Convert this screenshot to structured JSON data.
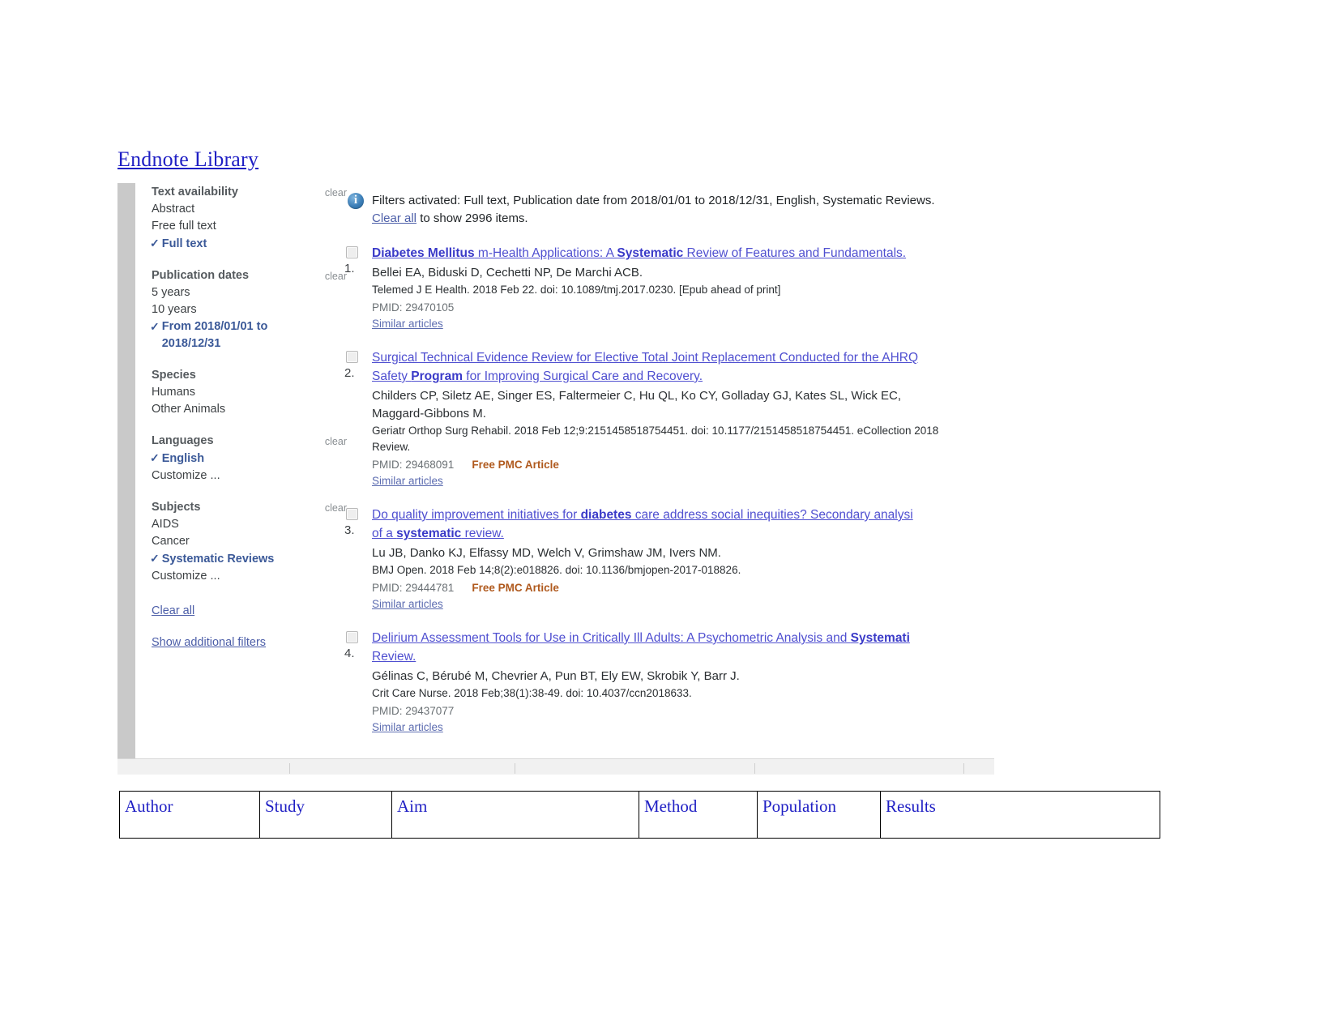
{
  "document": {
    "title_link": "Endnote Library"
  },
  "sidebar": {
    "groups": [
      {
        "heading": "Text availability",
        "clear_label": "clear",
        "has_clear": true,
        "items": [
          {
            "label": "Abstract",
            "selected": false
          },
          {
            "label": "Free full text",
            "selected": false
          },
          {
            "label": "Full text",
            "selected": true
          }
        ]
      },
      {
        "heading": "Publication dates",
        "clear_label": "clear",
        "has_clear": true,
        "items": [
          {
            "label": "5 years",
            "selected": false
          },
          {
            "label": "10 years",
            "selected": false
          },
          {
            "label": "From 2018/01/01 to 2018/12/31",
            "selected": true
          }
        ]
      },
      {
        "heading": "Species",
        "clear_label": "",
        "has_clear": false,
        "items": [
          {
            "label": "Humans",
            "selected": false
          },
          {
            "label": "Other Animals",
            "selected": false
          }
        ]
      },
      {
        "heading": "Languages",
        "clear_label": "clear",
        "has_clear": true,
        "items": [
          {
            "label": "English",
            "selected": true
          },
          {
            "label": "Customize ...",
            "selected": false
          }
        ]
      },
      {
        "heading": "Subjects",
        "clear_label": "clear",
        "has_clear": true,
        "items": [
          {
            "label": "AIDS",
            "selected": false
          },
          {
            "label": "Cancer",
            "selected": false
          },
          {
            "label": "Systematic Reviews",
            "selected": true
          },
          {
            "label": "Customize ...",
            "selected": false
          }
        ]
      }
    ],
    "clear_all_link": "Clear all",
    "show_additional_filters_link": "Show additional filters"
  },
  "banner": {
    "icon": "info-icon",
    "line1": "Filters activated: Full text, Publication date from 2018/01/01 to 2018/12/31, English, Systematic Reviews.",
    "clear_all": "Clear all",
    "line2_tail": " to show 2996 items."
  },
  "results": [
    {
      "number": "1.",
      "title_line1_pre": "",
      "title_bold1": "Diabetes Mellitus",
      "title_mid": " m-Health Applications: A ",
      "title_bold2": "Systematic",
      "title_post": " Review of Features and Fundamentals.",
      "title_line2": "",
      "authors": "Bellei EA, Biduski D, Cechetti NP, De Marchi ACB.",
      "source": "Telemed J E Health. 2018 Feb 22. doi: 10.1089/tmj.2017.0230. [Epub ahead of print]",
      "source2": "",
      "pmid": "PMID: 29470105",
      "pmc_tag": "",
      "similar": "Similar articles"
    },
    {
      "number": "2.",
      "title_line1_pre": "Surgical Technical Evidence Review for Elective Total Joint Replacement Conducted for the AHRQ",
      "title_bold1": "",
      "title_mid": "",
      "title_bold2": "",
      "title_post": "",
      "title_line2_pre": "Safety ",
      "title_line2_bold": "Program",
      "title_line2_post": " for Improving Surgical Care and Recovery.",
      "authors": "Childers CP, Siletz AE, Singer ES, Faltermeier C, Hu QL, Ko CY, Golladay GJ, Kates SL, Wick EC,",
      "authors2": "Maggard-Gibbons M.",
      "source": "Geriatr Orthop Surg Rehabil. 2018 Feb 12;9:2151458518754451. doi: 10.1177/2151458518754451. eCollection 2018",
      "source2": "Review.",
      "pmid": "PMID: 29468091",
      "pmc_tag": "Free PMC Article",
      "similar": "Similar articles"
    },
    {
      "number": "3.",
      "title_line1_pre": "Do quality improvement initiatives for ",
      "title_bold1": "diabetes",
      "title_mid": " care address social inequities? Secondary analysi",
      "title_line2_pre": "of a ",
      "title_line2_bold": "systematic",
      "title_line2_post": " review.",
      "authors": "Lu JB, Danko KJ, Elfassy MD, Welch V, Grimshaw JM, Ivers NM.",
      "source": "BMJ Open. 2018 Feb 14;8(2):e018826. doi: 10.1136/bmjopen-2017-018826.",
      "source2": "",
      "pmid": "PMID: 29444781",
      "pmc_tag": "Free PMC Article",
      "similar": "Similar articles"
    },
    {
      "number": "4.",
      "title_line1_pre": "Delirium Assessment Tools for Use in Critically Ill Adults: A Psychometric Analysis and ",
      "title_bold1": "Systemati",
      "title_mid": "",
      "title_line2_pre": "Review.",
      "title_line2_bold": "",
      "title_line2_post": "",
      "authors": "Gélinas C, Bérubé M, Chevrier A, Pun BT, Ely EW, Skrobik Y, Barr J.",
      "source": "Crit Care Nurse. 2018 Feb;38(1):38-49. doi: 10.4037/ccn2018633.",
      "source2": "",
      "pmid": "PMID: 29437077",
      "pmc_tag": "",
      "similar": "Similar articles"
    }
  ],
  "table": {
    "headers": [
      "Author",
      "Study",
      "Aim",
      "Method",
      "Population",
      "Results"
    ]
  },
  "colors": {
    "link_blue": "#1f1fc4",
    "result_link": "#4f4fd0",
    "filter_selected": "#3b5998",
    "pmc_orange": "#b05a1e",
    "rail_gray": "#c9c9c9"
  }
}
